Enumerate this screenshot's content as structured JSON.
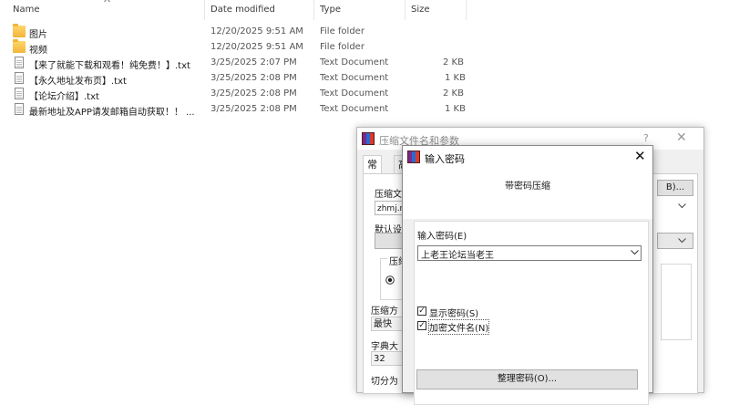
{
  "explorer": {
    "columns": {
      "name": "Name",
      "date": "Date modified",
      "type": "Type",
      "size": "Size"
    },
    "rows": [
      {
        "name": "图片",
        "date": "12/20/2025 9:51 AM",
        "type": "File folder",
        "size": "",
        "icon": "folder-icon"
      },
      {
        "name": "视频",
        "date": "12/20/2025 9:51 AM",
        "type": "File folder",
        "size": "",
        "icon": "folder-icon"
      },
      {
        "name": "【来了就能下载和观看！纯免费！】.txt",
        "date": "3/25/2025 2:07 PM",
        "type": "Text Document",
        "size": "2 KB",
        "icon": "text-file-icon"
      },
      {
        "name": "【永久地址发布页】.txt",
        "date": "3/25/2025 2:08 PM",
        "type": "Text Document",
        "size": "1 KB",
        "icon": "text-file-icon"
      },
      {
        "name": "【论坛介绍】.txt",
        "date": "3/25/2025 2:08 PM",
        "type": "Text Document",
        "size": "2 KB",
        "icon": "text-file-icon"
      },
      {
        "name": "最新地址及APP请发邮箱自动获取！！ ...",
        "date": "3/25/2025 2:08 PM",
        "type": "Text Document",
        "size": "1 KB",
        "icon": "text-file-icon"
      }
    ]
  },
  "archive_dialog": {
    "title": "压缩文件名和参数",
    "help": "?",
    "close": "✕",
    "tabs": [
      "常规",
      "高"
    ],
    "archive_name_label": "压缩文",
    "archive_name_value": "zhmj.r",
    "browse_button": "B)...",
    "default_profile_label": "默认设",
    "format_group_label": "压缩",
    "method_label": "压缩方",
    "method_value": "最快",
    "dict_label": "字典大",
    "dict_value": "32",
    "split_label": "切分为"
  },
  "password_dialog": {
    "title": "输入密码",
    "close": "✕",
    "heading": "带密码压缩",
    "password_label": "输入密码(E)",
    "password_value": "上老王论坛当老王",
    "show_password": {
      "label": "显示密码(S)",
      "checked": true
    },
    "encrypt_filenames": {
      "label": "加密文件名(N)",
      "checked": true
    },
    "organize_button": "整理密码(O)..."
  }
}
